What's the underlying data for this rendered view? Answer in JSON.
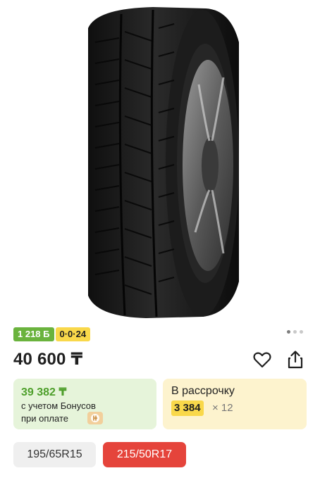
{
  "product": {
    "image_alt": "tire",
    "bonus_badge": "1 218 Б",
    "installment_badge": "0·0·24",
    "price": "40 600 ₸",
    "gallery": {
      "total": 3,
      "active": 0
    }
  },
  "actions": {
    "favorite_icon": "heart-icon",
    "share_icon": "share-icon"
  },
  "bonus_card": {
    "price": "39 382 ₸",
    "line1": "с учетом Бонусов",
    "line2": "при оплате"
  },
  "installment_card": {
    "title": "В рассрочку",
    "amount": "3 384",
    "multiplier": "× 12"
  },
  "sizes": [
    {
      "label": "195/65R15",
      "selected": false
    },
    {
      "label": "215/50R17",
      "selected": true
    }
  ],
  "colors": {
    "bonus_green": "#6ab33d",
    "installment_yellow": "#f9d84a",
    "selected_red": "#e5443b"
  }
}
